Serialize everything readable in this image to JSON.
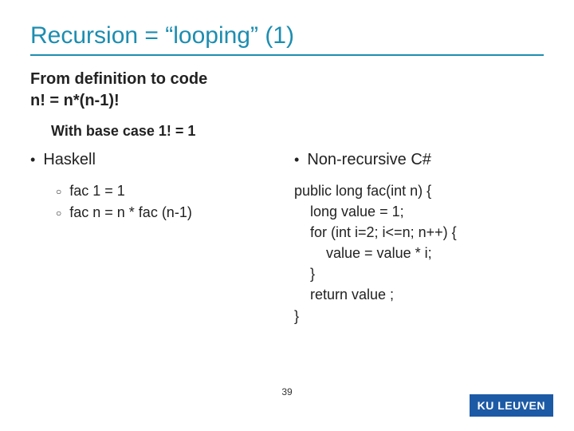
{
  "title": "Recursion = “looping” (1)",
  "subtitle_line1": "From definition to code",
  "subtitle_line2": "n! = n*(n-1)!",
  "basecase": "With base case 1! = 1",
  "left": {
    "heading": "Haskell",
    "items": [
      "fac 1 = 1",
      "fac n = n * fac (n-1)"
    ]
  },
  "right": {
    "heading": "Non-recursive C#",
    "code": "public long fac(int n) {\n    long value = 1;\n    for (int i=2; i<=n; n++) {\n        value = value * i;\n    }\n    return value ;\n}"
  },
  "page_number": "39",
  "logo_text": "KU LEUVEN"
}
